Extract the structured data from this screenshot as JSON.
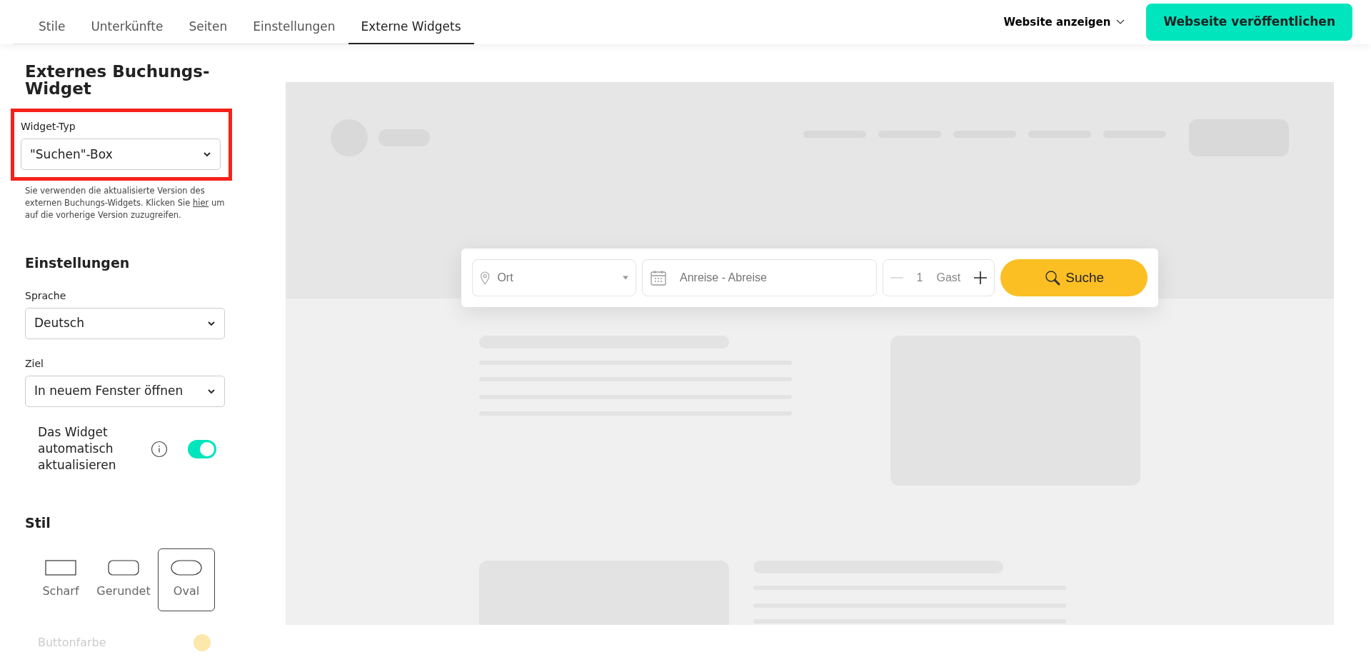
{
  "tabs": [
    {
      "label": "Stile",
      "selected": false
    },
    {
      "label": "Unterkünfte",
      "selected": false
    },
    {
      "label": "Seiten",
      "selected": false
    },
    {
      "label": "Einstellungen",
      "selected": false
    },
    {
      "label": "Externe Widgets",
      "selected": true
    }
  ],
  "header": {
    "view_menu": "Website anzeigen",
    "publish_button": "Webseite veröffentlichen"
  },
  "sidebar": {
    "title": "Externes Buchungs-Widget",
    "widget_type": {
      "label": "Widget-Typ",
      "value": "\"Suchen\"-Box",
      "highlighted": true
    },
    "note": {
      "before": "Sie verwenden die aktualisierte Version des externen Buchungs-Widgets. Klicken Sie",
      "link": "hier",
      "after": "um auf die vorherige Version zuzugreifen."
    },
    "settings_title": "Einstellungen",
    "fields": [
      {
        "label": "Sprache",
        "value": "Deutsch"
      },
      {
        "label": "Ziel",
        "value": "In neuem Fenster öffnen"
      }
    ],
    "auto_update": {
      "label": "Das Widget automatisch aktualisieren",
      "on": true
    },
    "style_title": "Stil",
    "styles": [
      {
        "label": "Scharf",
        "kind": "sharp",
        "selected": false
      },
      {
        "label": "Gerundet",
        "kind": "rounded",
        "selected": false
      },
      {
        "label": "Oval",
        "kind": "oval",
        "selected": true
      }
    ],
    "button_color": {
      "label": "Buttonfarbe",
      "color": "#fce8ab",
      "disabled": true
    }
  },
  "preview": {
    "location_placeholder": "Ort",
    "dates_placeholder": "Anreise - Abreise",
    "guests": "1",
    "guests_label": "Gast",
    "search_button": "Suche"
  }
}
